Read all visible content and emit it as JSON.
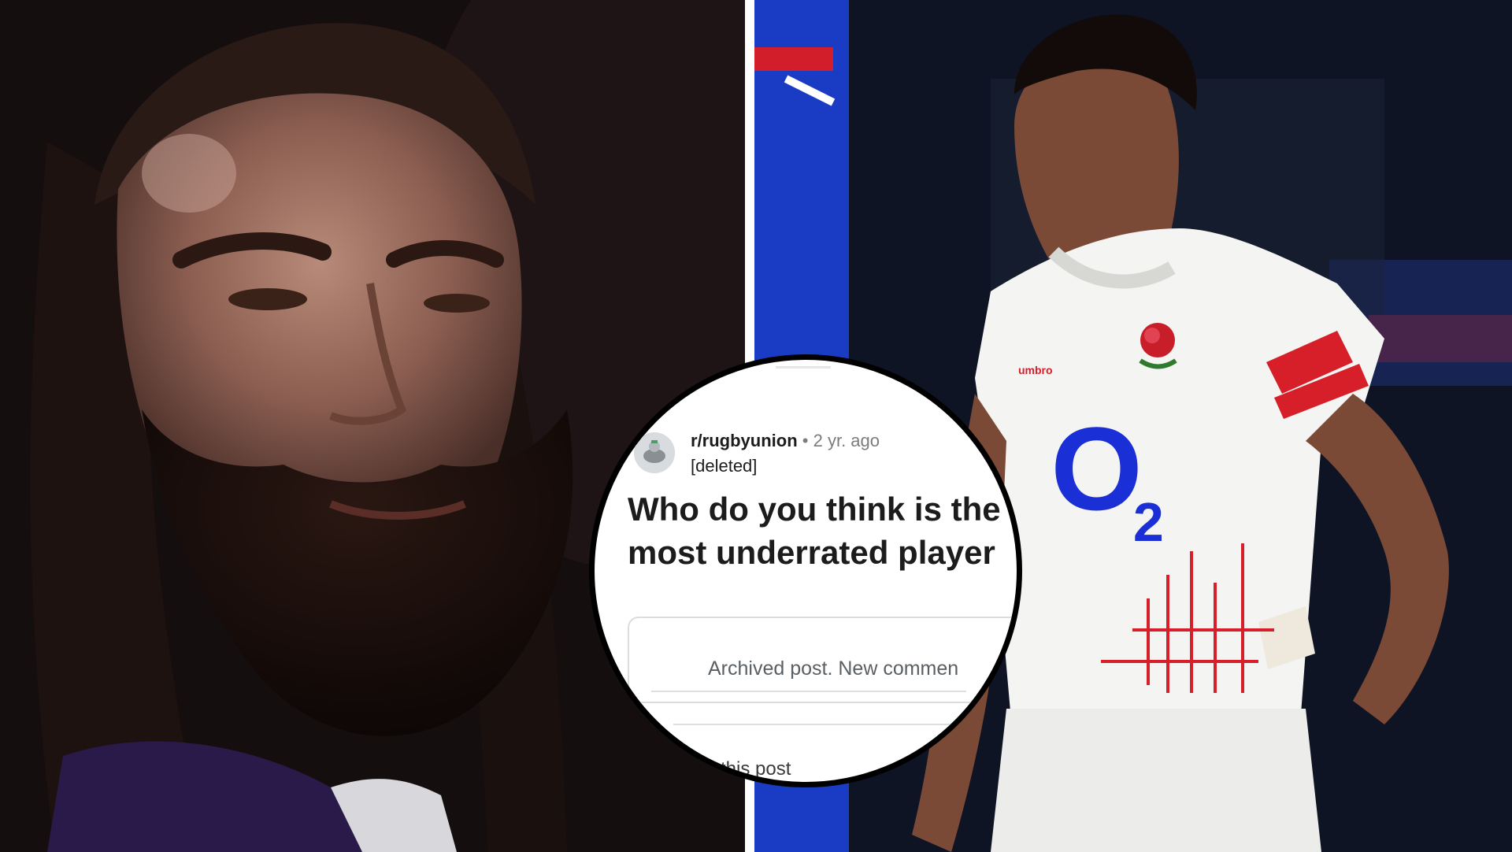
{
  "left_photo": {
    "subject": "bearded-rugby-player"
  },
  "right_photo": {
    "subject": "rugby-player-white-england-kit",
    "sponsor": {
      "main": "O",
      "sub": "2"
    },
    "kit_brand": "umbro",
    "colors": {
      "kit": "#f4f4f2",
      "sponsor": "#1a2fd6",
      "trim": "#d71f2a",
      "background": "#0e1424"
    }
  },
  "callout": {
    "subreddit": "r/rugbyunion",
    "separator": "•",
    "age": "2 yr. ago",
    "author": "[deleted]",
    "title_line_1": "Who do you think is the",
    "title_line_2": "most underrated player",
    "archived_text": "Archived post. New commen",
    "footer_fragment": "this post",
    "colors": {
      "background": "#ffffff",
      "border": "#000000",
      "text": "#1c1c1c",
      "muted": "#7c7c7c"
    }
  }
}
